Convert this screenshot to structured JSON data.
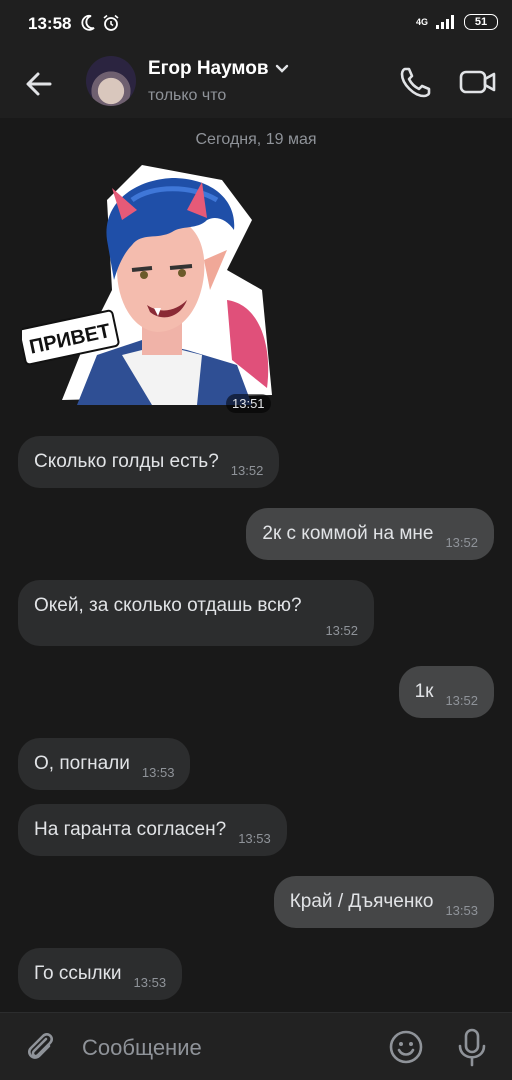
{
  "status_bar": {
    "time": "13:58",
    "network": "4G",
    "battery": "51"
  },
  "header": {
    "contact_name": "Егор Наумов",
    "contact_status": "только что"
  },
  "chat": {
    "date_separator": "Сегодня, 19 мая",
    "sticker": {
      "text": "ПРИВЕТ",
      "time": "13:51"
    },
    "messages": [
      {
        "direction": "in",
        "text": "Сколько голды есть?",
        "time": "13:52"
      },
      {
        "direction": "out",
        "text": "2к с коммой на мне",
        "time": "13:52"
      },
      {
        "direction": "in",
        "text": "Окей, за сколько отдашь всю?",
        "time": "13:52"
      },
      {
        "direction": "out",
        "text": "1к",
        "time": "13:52"
      },
      {
        "direction": "in",
        "text": "О, погнали",
        "time": "13:53"
      },
      {
        "direction": "in",
        "text": "На гаранта согласен?",
        "time": "13:53"
      },
      {
        "direction": "out",
        "text": "Край / Дъяченко",
        "time": "13:53"
      },
      {
        "direction": "in",
        "text": "Го ссылки",
        "time": "13:53"
      }
    ]
  },
  "composer": {
    "placeholder": "Сообщение"
  },
  "colors": {
    "background": "#191919",
    "incoming_bubble": "#2c2d2e",
    "outgoing_bubble": "#454647",
    "secondary_text": "#8f9399"
  },
  "icons": [
    "back-arrow-icon",
    "chevron-down-icon",
    "phone-icon",
    "video-camera-icon",
    "paperclip-icon",
    "smile-icon",
    "microphone-icon",
    "moon-icon",
    "alarm-icon",
    "signal-icon"
  ]
}
